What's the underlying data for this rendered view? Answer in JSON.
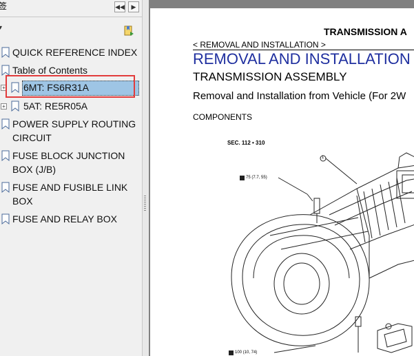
{
  "bookmarks_pane": {
    "title_fragment": "签",
    "nav_prev": "◀◀",
    "nav_next": "▶",
    "items": [
      {
        "label": "QUICK REFERENCE INDEX"
      },
      {
        "label": "Table of Contents"
      },
      {
        "label": "6MT: FS6R31A",
        "selected": true,
        "expander": "+"
      },
      {
        "label": "5AT: RE5R05A",
        "expander": "+"
      },
      {
        "label": "POWER SUPPLY ROUTING CIRCUIT"
      },
      {
        "label": "FUSE BLOCK JUNCTION BOX (J/B)"
      },
      {
        "label": "FUSE AND FUSIBLE LINK BOX"
      },
      {
        "label": "FUSE AND RELAY BOX"
      }
    ]
  },
  "document": {
    "header": "TRANSMISSION A",
    "breadcrumb": "< REMOVAL AND INSTALLATION >",
    "title": "REMOVAL AND INSTALLATION",
    "subtitle": "TRANSMISSION ASSEMBLY",
    "section": "Removal and Installation from Vehicle (For 2W",
    "components_label": "COMPONENTS",
    "figure_sec": "SEC. 112 • 310",
    "callout_1": "1",
    "torque_1": "75 (7.7, 55)",
    "torque_2": "100 (10, 74)"
  },
  "colors": {
    "title_blue": "#1f2f9f",
    "selection": "#9ec5e5",
    "highlight": "#e23b3b"
  }
}
